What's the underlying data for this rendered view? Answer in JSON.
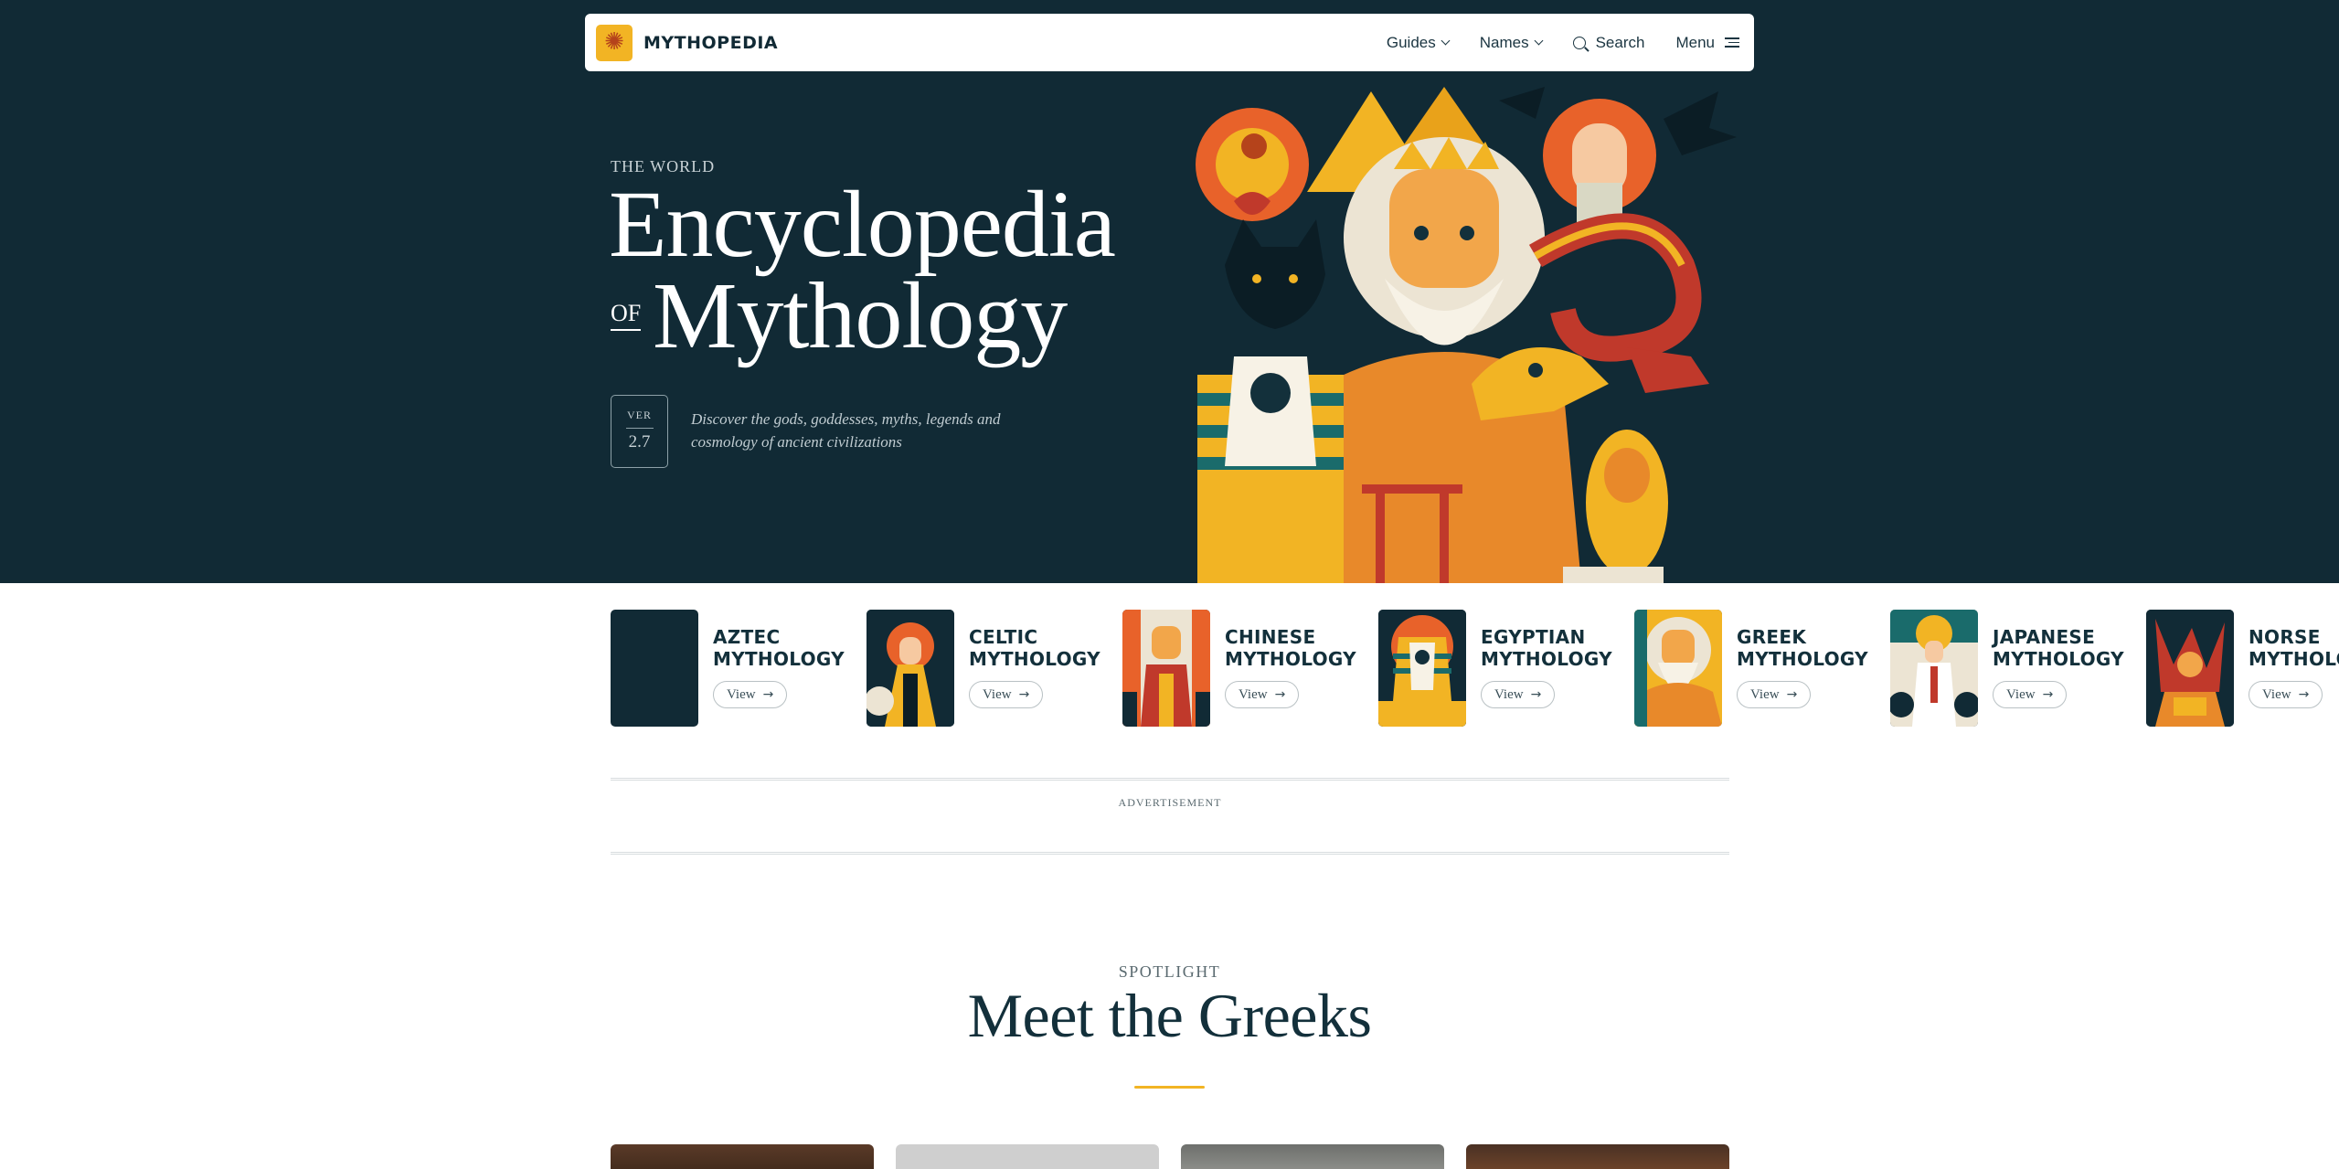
{
  "brand": {
    "name": "MYTHOPEDIA",
    "accent": "#f2b424",
    "navy": "#112a35"
  },
  "nav": {
    "guides_label": "Guides",
    "names_label": "Names",
    "search_label": "Search",
    "menu_label": "Menu"
  },
  "hero": {
    "eyebrow": "THE WORLD",
    "title_line1": "Encyclopedia",
    "of_label": "OF",
    "title_line2": "Mythology",
    "version_label": "VER",
    "version_number": "2.7",
    "tagline": "Discover the gods, goddesses, myths, legends and cosmology of ancient civilizations"
  },
  "categories": [
    {
      "line1": "AZTEC",
      "line2": "MYTHOLOGY",
      "button": "View"
    },
    {
      "line1": "CELTIC",
      "line2": "MYTHOLOGY",
      "button": "View"
    },
    {
      "line1": "CHINESE",
      "line2": "MYTHOLOGY",
      "button": "View"
    },
    {
      "line1": "EGYPTIAN",
      "line2": "MYTHOLOGY",
      "button": "View"
    },
    {
      "line1": "GREEK",
      "line2": "MYTHOLOGY",
      "button": "View"
    },
    {
      "line1": "JAPANESE",
      "line2": "MYTHOLOGY",
      "button": "View"
    },
    {
      "line1": "NORSE",
      "line2": "MYTHOLOGY",
      "button": "View"
    }
  ],
  "ad": {
    "label": "ADVERTISEMENT"
  },
  "spotlight": {
    "eyebrow": "SPOTLIGHT",
    "title": "Meet the Greeks"
  }
}
